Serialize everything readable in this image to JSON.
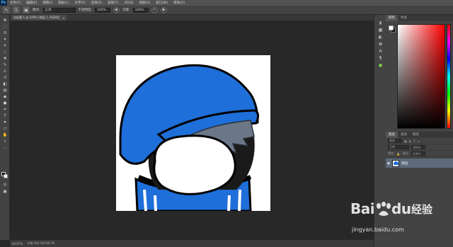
{
  "app": {
    "logo": "Ps"
  },
  "menu": [
    "文件(F)",
    "编辑(E)",
    "图像(I)",
    "图层(L)",
    "文字(Y)",
    "选择(S)",
    "滤镜(T)",
    "3D(D)",
    "视图(V)",
    "窗口(W)",
    "帮助(H)"
  ],
  "options": {
    "brush_size": "5",
    "mode_label": "模式:",
    "mode_value": "正常",
    "opacity_label": "不透明度:",
    "opacity_value": "100%",
    "flow_label": "流量:",
    "flow_value": "100%"
  },
  "document_tab": {
    "label": "未标题-1 @ 100% (图层 1, RGB/8)",
    "close": "×"
  },
  "status": {
    "zoom": "66.67%",
    "doc_info": "文档:316.7K/316.7K"
  },
  "panels": {
    "color_tabs": [
      "颜色",
      "色板"
    ],
    "layers_tabs": [
      "图层",
      "通道",
      "路径"
    ],
    "filter_label": "类型",
    "blend_mode": "正常",
    "opacity": "100%",
    "lock_label": "锁定:",
    "fill_label": "填充:",
    "fill_value": "100%",
    "layer_name": "图层"
  },
  "watermark": {
    "brand": "Bai",
    "brand2": "du",
    "cn": "经验",
    "url": "jingyan.baidu.com"
  },
  "colors": {
    "helmet_blue": "#1e6fd9",
    "ui_dark": "#282828",
    "panel": "#434343"
  }
}
